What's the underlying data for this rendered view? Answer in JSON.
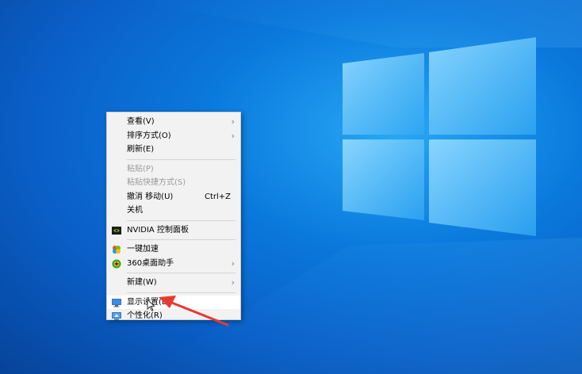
{
  "context_menu": {
    "items": [
      {
        "label": "查看(V)",
        "submenu": true
      },
      {
        "label": "排序方式(O)",
        "submenu": true
      },
      {
        "label": "刷新(E)"
      },
      {
        "label": "粘贴(P)",
        "disabled": true
      },
      {
        "label": "粘贴快捷方式(S)",
        "disabled": true
      },
      {
        "label": "撤消 移动(U)",
        "shortcut": "Ctrl+Z"
      },
      {
        "label": "关机"
      },
      {
        "label": "NVIDIA 控制面板",
        "icon": "nvidia-icon"
      },
      {
        "label": "一键加速",
        "icon": "speedup-icon"
      },
      {
        "label": "360桌面助手",
        "icon": "desktop-assistant-icon",
        "submenu": true
      },
      {
        "label": "新建(W)",
        "submenu": true
      },
      {
        "label": "显示设置(D)",
        "icon": "display-settings-icon",
        "highlighted": true
      },
      {
        "label": "个性化(R)",
        "icon": "personalize-icon"
      }
    ],
    "submenu_arrow": "›"
  },
  "colors": {
    "desktop": "#0a6fd6",
    "menu_bg": "#f2f2f2",
    "annotation_arrow": "#e8392f"
  }
}
